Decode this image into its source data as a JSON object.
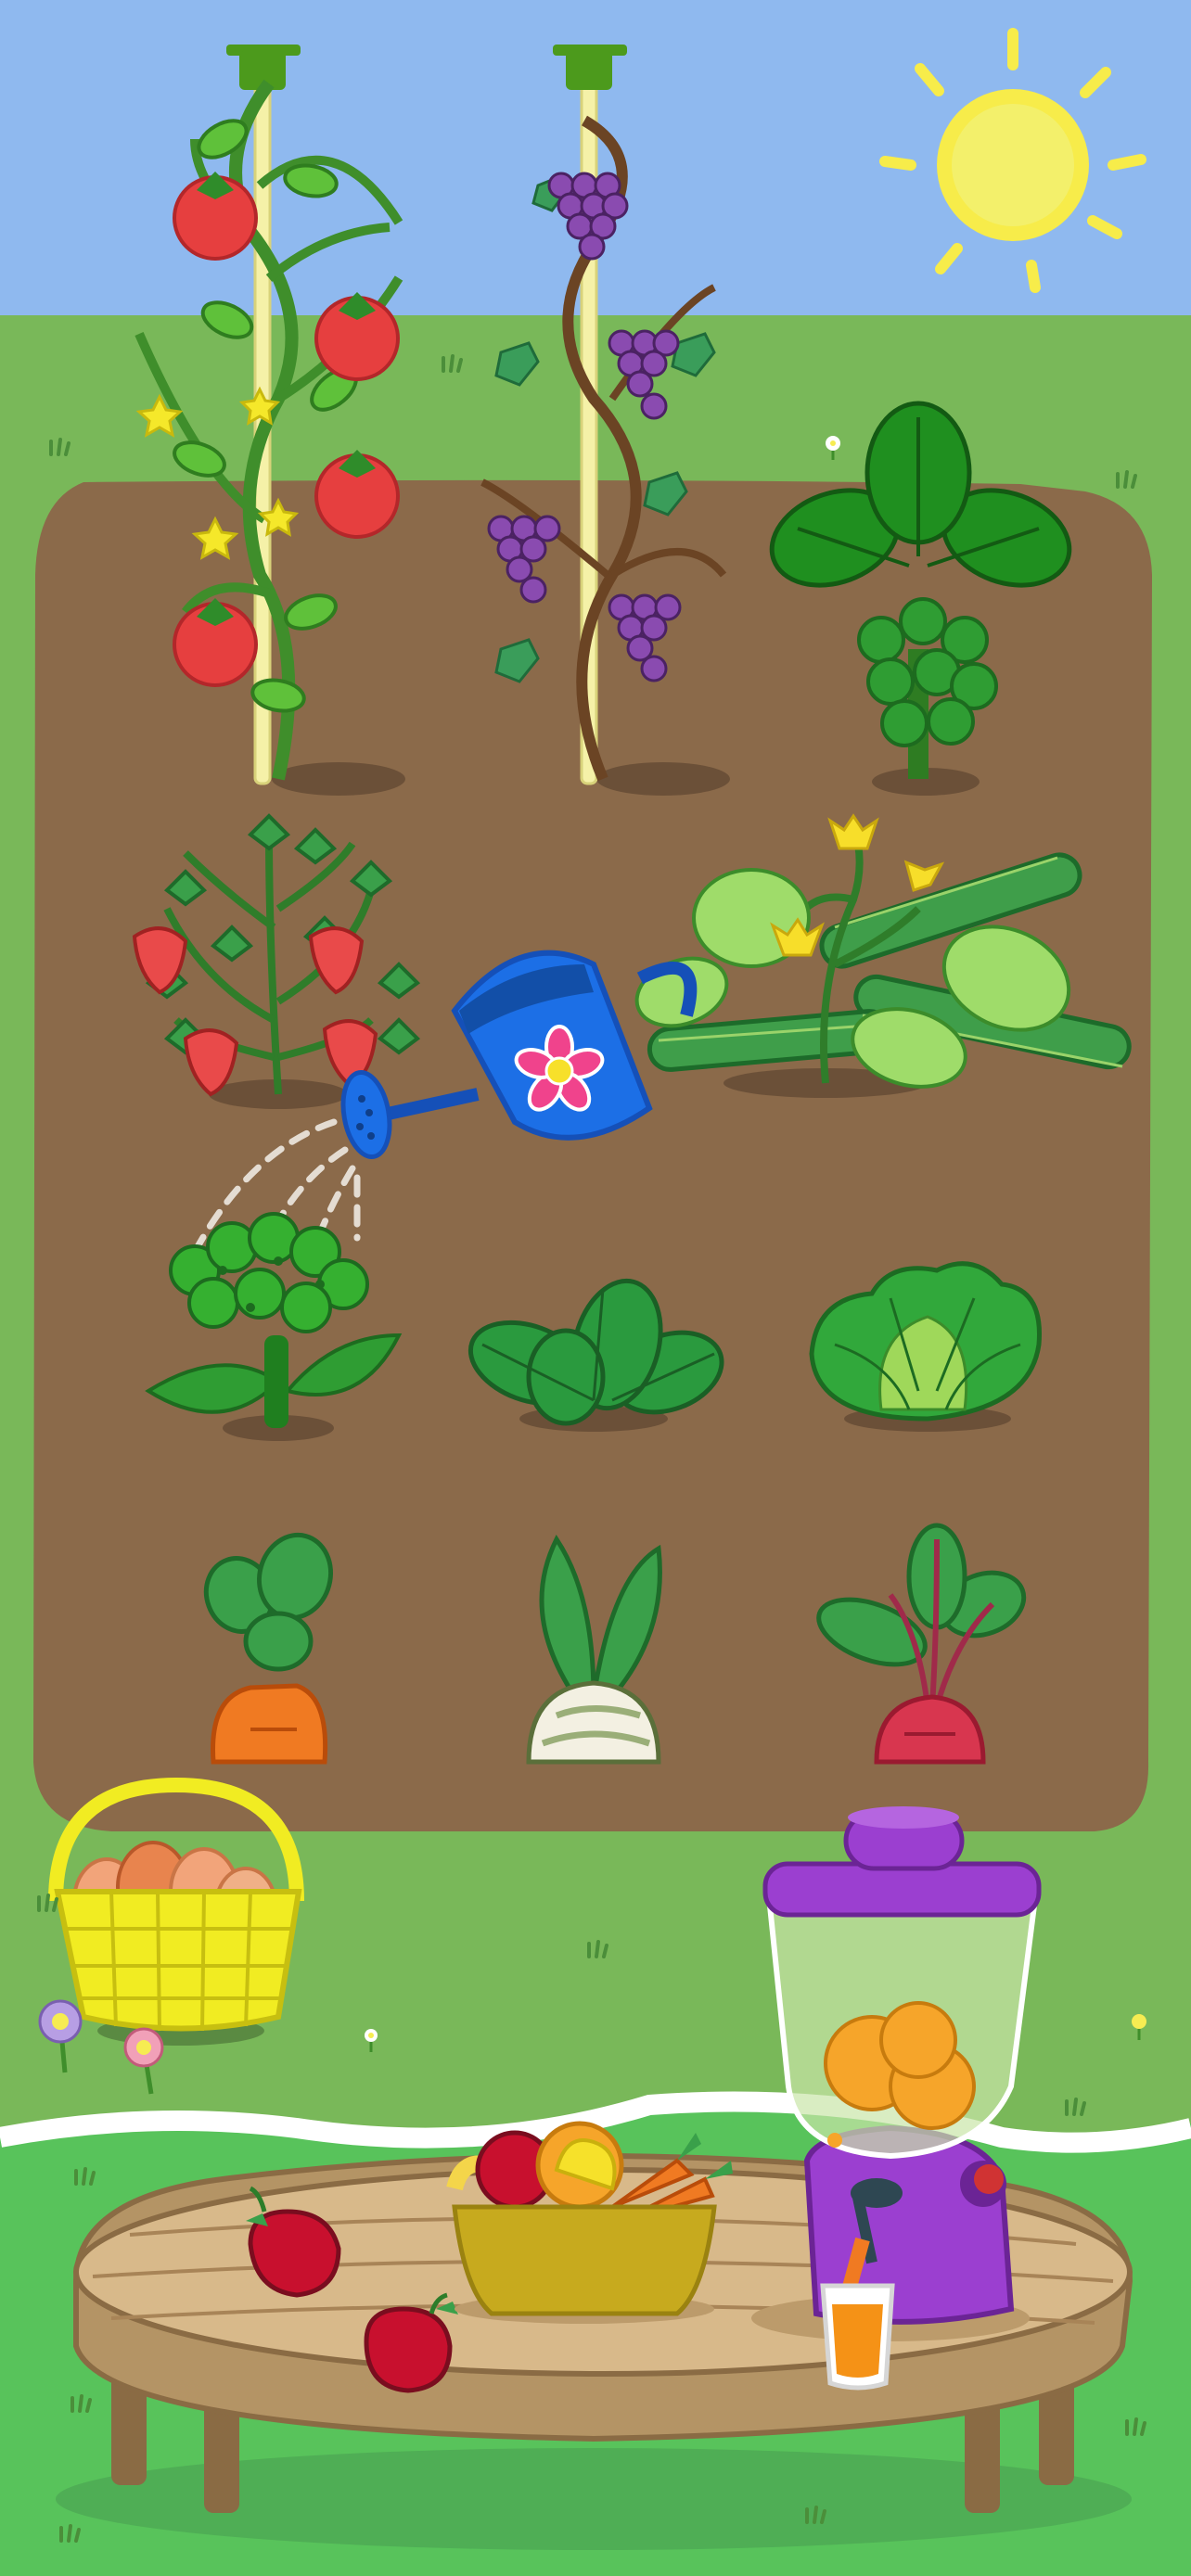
{
  "scene": {
    "type": "garden-game",
    "colors": {
      "sky": "#8fb9ef",
      "grass_back": "#79b859",
      "grass_front": "#58c35b",
      "soil": "#8b6a4a",
      "sun": "#f7ec4a",
      "table_top": "#d8b98a",
      "table_edge": "#8a6b44",
      "watering_can": "#1c6fe6",
      "blender": "#9b3fd0",
      "basket": "#f1ec22"
    }
  },
  "plants": {
    "row1": [
      "tomato-vine",
      "grape-vine",
      "broccoli-plant"
    ],
    "row2": [
      "strawberry-plant",
      "cucumber-plant"
    ],
    "row3": [
      "broccoli",
      "spinach",
      "lettuce"
    ],
    "row4": [
      "carrot",
      "turnip",
      "beetroot"
    ]
  },
  "items": {
    "watering_can": "watering-can",
    "egg_basket": "egg-basket",
    "fruit_bowl": "fruit-bowl",
    "blender": "blender",
    "juice_glass": "juice-glass",
    "apples_on_table": 2
  }
}
